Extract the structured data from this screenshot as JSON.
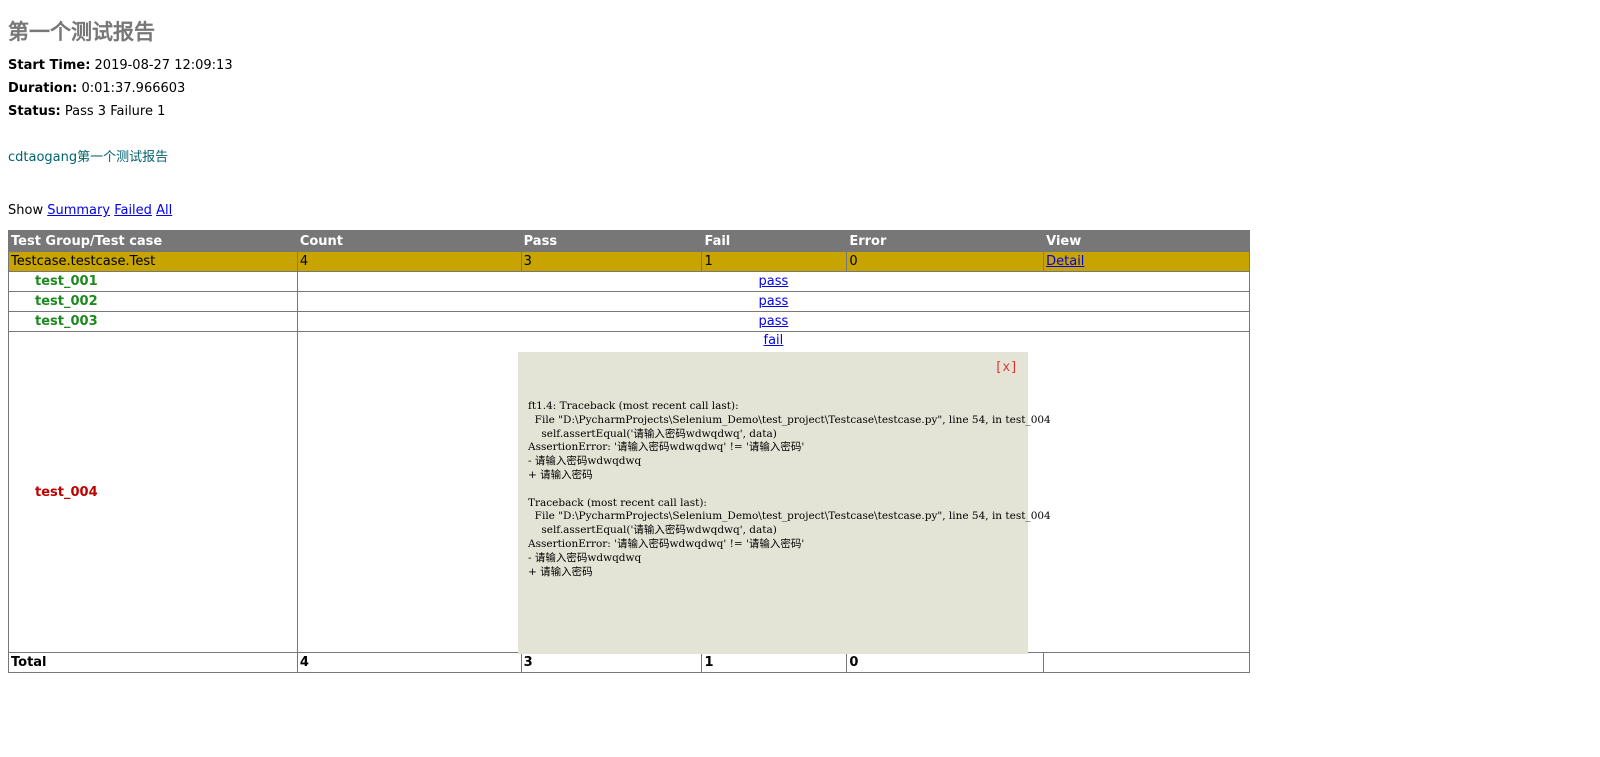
{
  "report": {
    "title": "第一个测试报告",
    "start_time_label": "Start Time:",
    "start_time": "2019-08-27 12:09:13",
    "duration_label": "Duration:",
    "duration": "0:01:37.966603",
    "status_label": "Status:",
    "status": "Pass 3 Failure 1",
    "description": "cdtaogang第一个测试报告"
  },
  "filter": {
    "label": "Show",
    "summary": "Summary",
    "failed": "Failed",
    "all": "All"
  },
  "table": {
    "headers": [
      "Test Group/Test case",
      "Count",
      "Pass",
      "Fail",
      "Error",
      "View"
    ],
    "group": {
      "name": "Testcase.testcase.Test",
      "count": "4",
      "pass": "3",
      "fail": "1",
      "error": "0",
      "view": "Detail"
    },
    "cases": [
      {
        "name": "test_001",
        "result": "pass"
      },
      {
        "name": "test_002",
        "result": "pass"
      },
      {
        "name": "test_003",
        "result": "pass"
      },
      {
        "name": "test_004",
        "result": "fail"
      }
    ],
    "total": {
      "label": "Total",
      "count": "4",
      "pass": "3",
      "fail": "1",
      "error": "0"
    }
  },
  "popup": {
    "close": "[x]",
    "traceback": "ft1.4: Traceback (most recent call last):\n  File \"D:\\PycharmProjects\\Selenium_Demo\\test_project\\Testcase\\testcase.py\", line 54, in test_004\n    self.assertEqual('请输入密码wdwqdwq', data)\nAssertionError: '请输入密码wdwqdwq' != '请输入密码'\n- 请输入密码wdwqdwq\n+ 请输入密码\n\nTraceback (most recent call last):\n  File \"D:\\PycharmProjects\\Selenium_Demo\\test_project\\Testcase\\testcase.py\", line 54, in test_004\n    self.assertEqual('请输入密码wdwqdwq', data)\nAssertionError: '请输入密码wdwqdwq' != '请输入密码'\n- 请输入密码wdwqdwq\n+ 请输入密码"
  },
  "colors": {
    "header_bg": "#777777",
    "group_bg": "#c8a400",
    "pass_text": "#1c8a1c",
    "fail_text": "#c00000",
    "popup_bg": "#e4e4d6"
  }
}
